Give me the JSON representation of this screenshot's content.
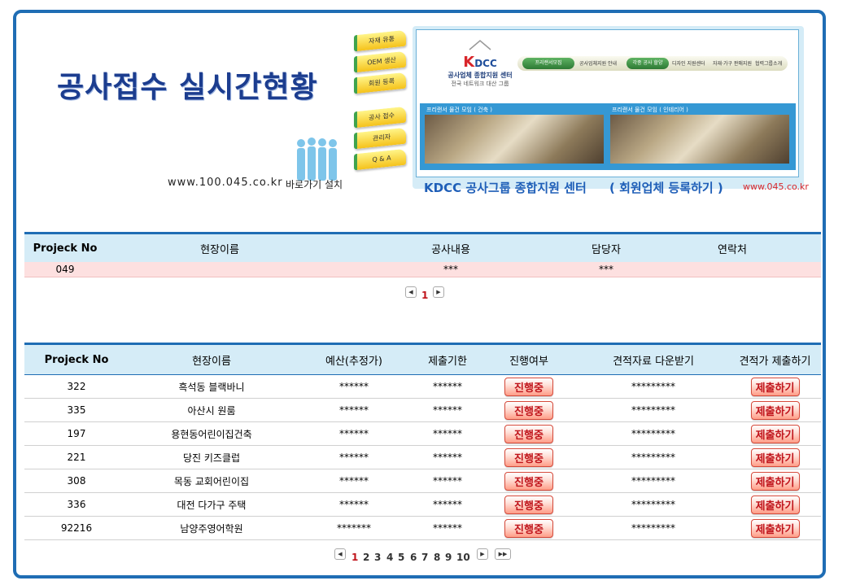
{
  "header": {
    "title": "공사접수 실시간현황",
    "url": "www.100.045.co.kr",
    "shortcut_label": "바로가기 설치"
  },
  "side_menu": [
    "자재 유통",
    "OEM 생산",
    "회원 등록",
    "공사 접수",
    "관리자",
    "Q & A"
  ],
  "banner": {
    "logo_main_k": "K",
    "logo_main_rest": "DCC",
    "logo_sub1": "공사업체 종합지원 센터",
    "logo_sub2": "전국 네트워크 대산 그룹",
    "nav": [
      "프리랜서모집",
      "공사업체지원 안내",
      "각종 공사 할양",
      "디자인 지원센터",
      "자재·가구 판매지원",
      "협력그룹소개"
    ],
    "photo_caption_1": "프리랜서 물건 모임 ( 건축 )",
    "photo_caption_2": "프리랜서 물건 모임 ( 인테리어 )",
    "footer_left": "KDCC 공사그룹 종합지원 센터",
    "footer_mid": "( 회원업체 등록하기 )",
    "footer_url": "www.045.co.kr"
  },
  "table1": {
    "headers": [
      "Projeck No",
      "현장이름",
      "공사내용",
      "담당자",
      "연락처"
    ],
    "rows": [
      {
        "no": "049",
        "name": "",
        "content": "***",
        "manager": "***",
        "contact": ""
      }
    ],
    "pager": {
      "current": "1"
    }
  },
  "table2": {
    "headers": [
      "Projeck No",
      "현장이름",
      "예산(추정가)",
      "제출기한",
      "진행여부",
      "견적자료 다운받기",
      "견적가 제출하기"
    ],
    "progress_label": "진행중",
    "submit_label": "제출하기",
    "rows": [
      {
        "no": "322",
        "name": "흑석동 블랙바니",
        "budget": "******",
        "deadline": "******",
        "download": "*********"
      },
      {
        "no": "335",
        "name": "아산시 원룸",
        "budget": "******",
        "deadline": "******",
        "download": "*********"
      },
      {
        "no": "197",
        "name": "용현동어린이집건축",
        "budget": "******",
        "deadline": "******",
        "download": "*********"
      },
      {
        "no": "221",
        "name": "당진 키즈클럽",
        "budget": "******",
        "deadline": "******",
        "download": "*********"
      },
      {
        "no": "308",
        "name": "목동 교회어린이집",
        "budget": "******",
        "deadline": "******",
        "download": "*********"
      },
      {
        "no": "336",
        "name": "대전 다가구 주택",
        "budget": "******",
        "deadline": "******",
        "download": "*********"
      },
      {
        "no": "92216",
        "name": "남양주영어학원",
        "budget": "*******",
        "deadline": "******",
        "download": "*********"
      }
    ],
    "pager": {
      "pages": [
        "1",
        "2",
        "3",
        "4",
        "5",
        "6",
        "7",
        "8",
        "9",
        "10"
      ],
      "current": "1"
    }
  },
  "colors": {
    "accent": "#1f6db4",
    "header_bg": "#d5ecf7",
    "highlight_row": "#fde0e0",
    "button_text": "#c0141b"
  }
}
